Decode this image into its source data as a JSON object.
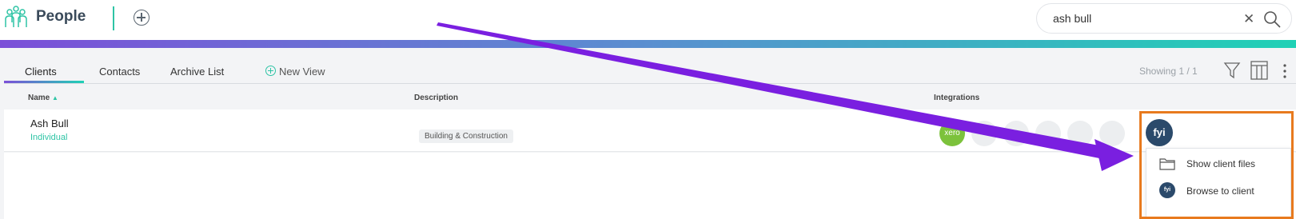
{
  "header": {
    "title": "People",
    "search": {
      "value": "ash bull",
      "placeholder": ""
    }
  },
  "tabs": [
    {
      "label": "Clients",
      "active": true
    },
    {
      "label": "Contacts",
      "active": false
    },
    {
      "label": "Archive List",
      "active": false
    }
  ],
  "new_view_label": "New View",
  "showing_text": "Showing 1 / 1",
  "table": {
    "columns": [
      "Name",
      "Description",
      "Integrations"
    ],
    "sort_column": "Name",
    "sort_direction": "ascending",
    "rows": [
      {
        "name": "Ash Bull",
        "type": "Individual",
        "description": "Building & Construction",
        "integrations": [
          "xero",
          "fyi"
        ]
      }
    ]
  },
  "xero_label": "xero",
  "fyi_label": "fyi",
  "fyi_menu": {
    "items": [
      {
        "label": "Show client files",
        "icon": "folder-icon"
      },
      {
        "label": "Browse to client",
        "icon": "fyi-icon"
      }
    ]
  },
  "colors": {
    "accent_teal": "#2ec4a5",
    "accent_purple": "#7b4fd8",
    "annotation_arrow": "#7a1fe0",
    "annotation_box": "#e87a1e",
    "fyi_navy": "#2b4a6b",
    "xero_green": "#7cc23c"
  }
}
